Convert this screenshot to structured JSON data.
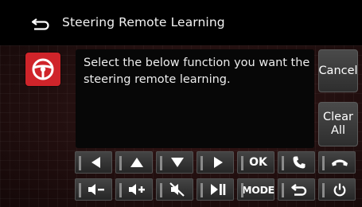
{
  "header": {
    "title": "Steering Remote Learning"
  },
  "message": {
    "text": "Select the below function you want the steering remote learning."
  },
  "buttons": {
    "cancel": "Cancel",
    "clear_line1": "Clear",
    "clear_line2": "All"
  },
  "keys": {
    "ok": "OK",
    "mode": "MODE"
  },
  "colors": {
    "accent": "#d0242a",
    "background": "#000000",
    "panel": "#241010"
  }
}
